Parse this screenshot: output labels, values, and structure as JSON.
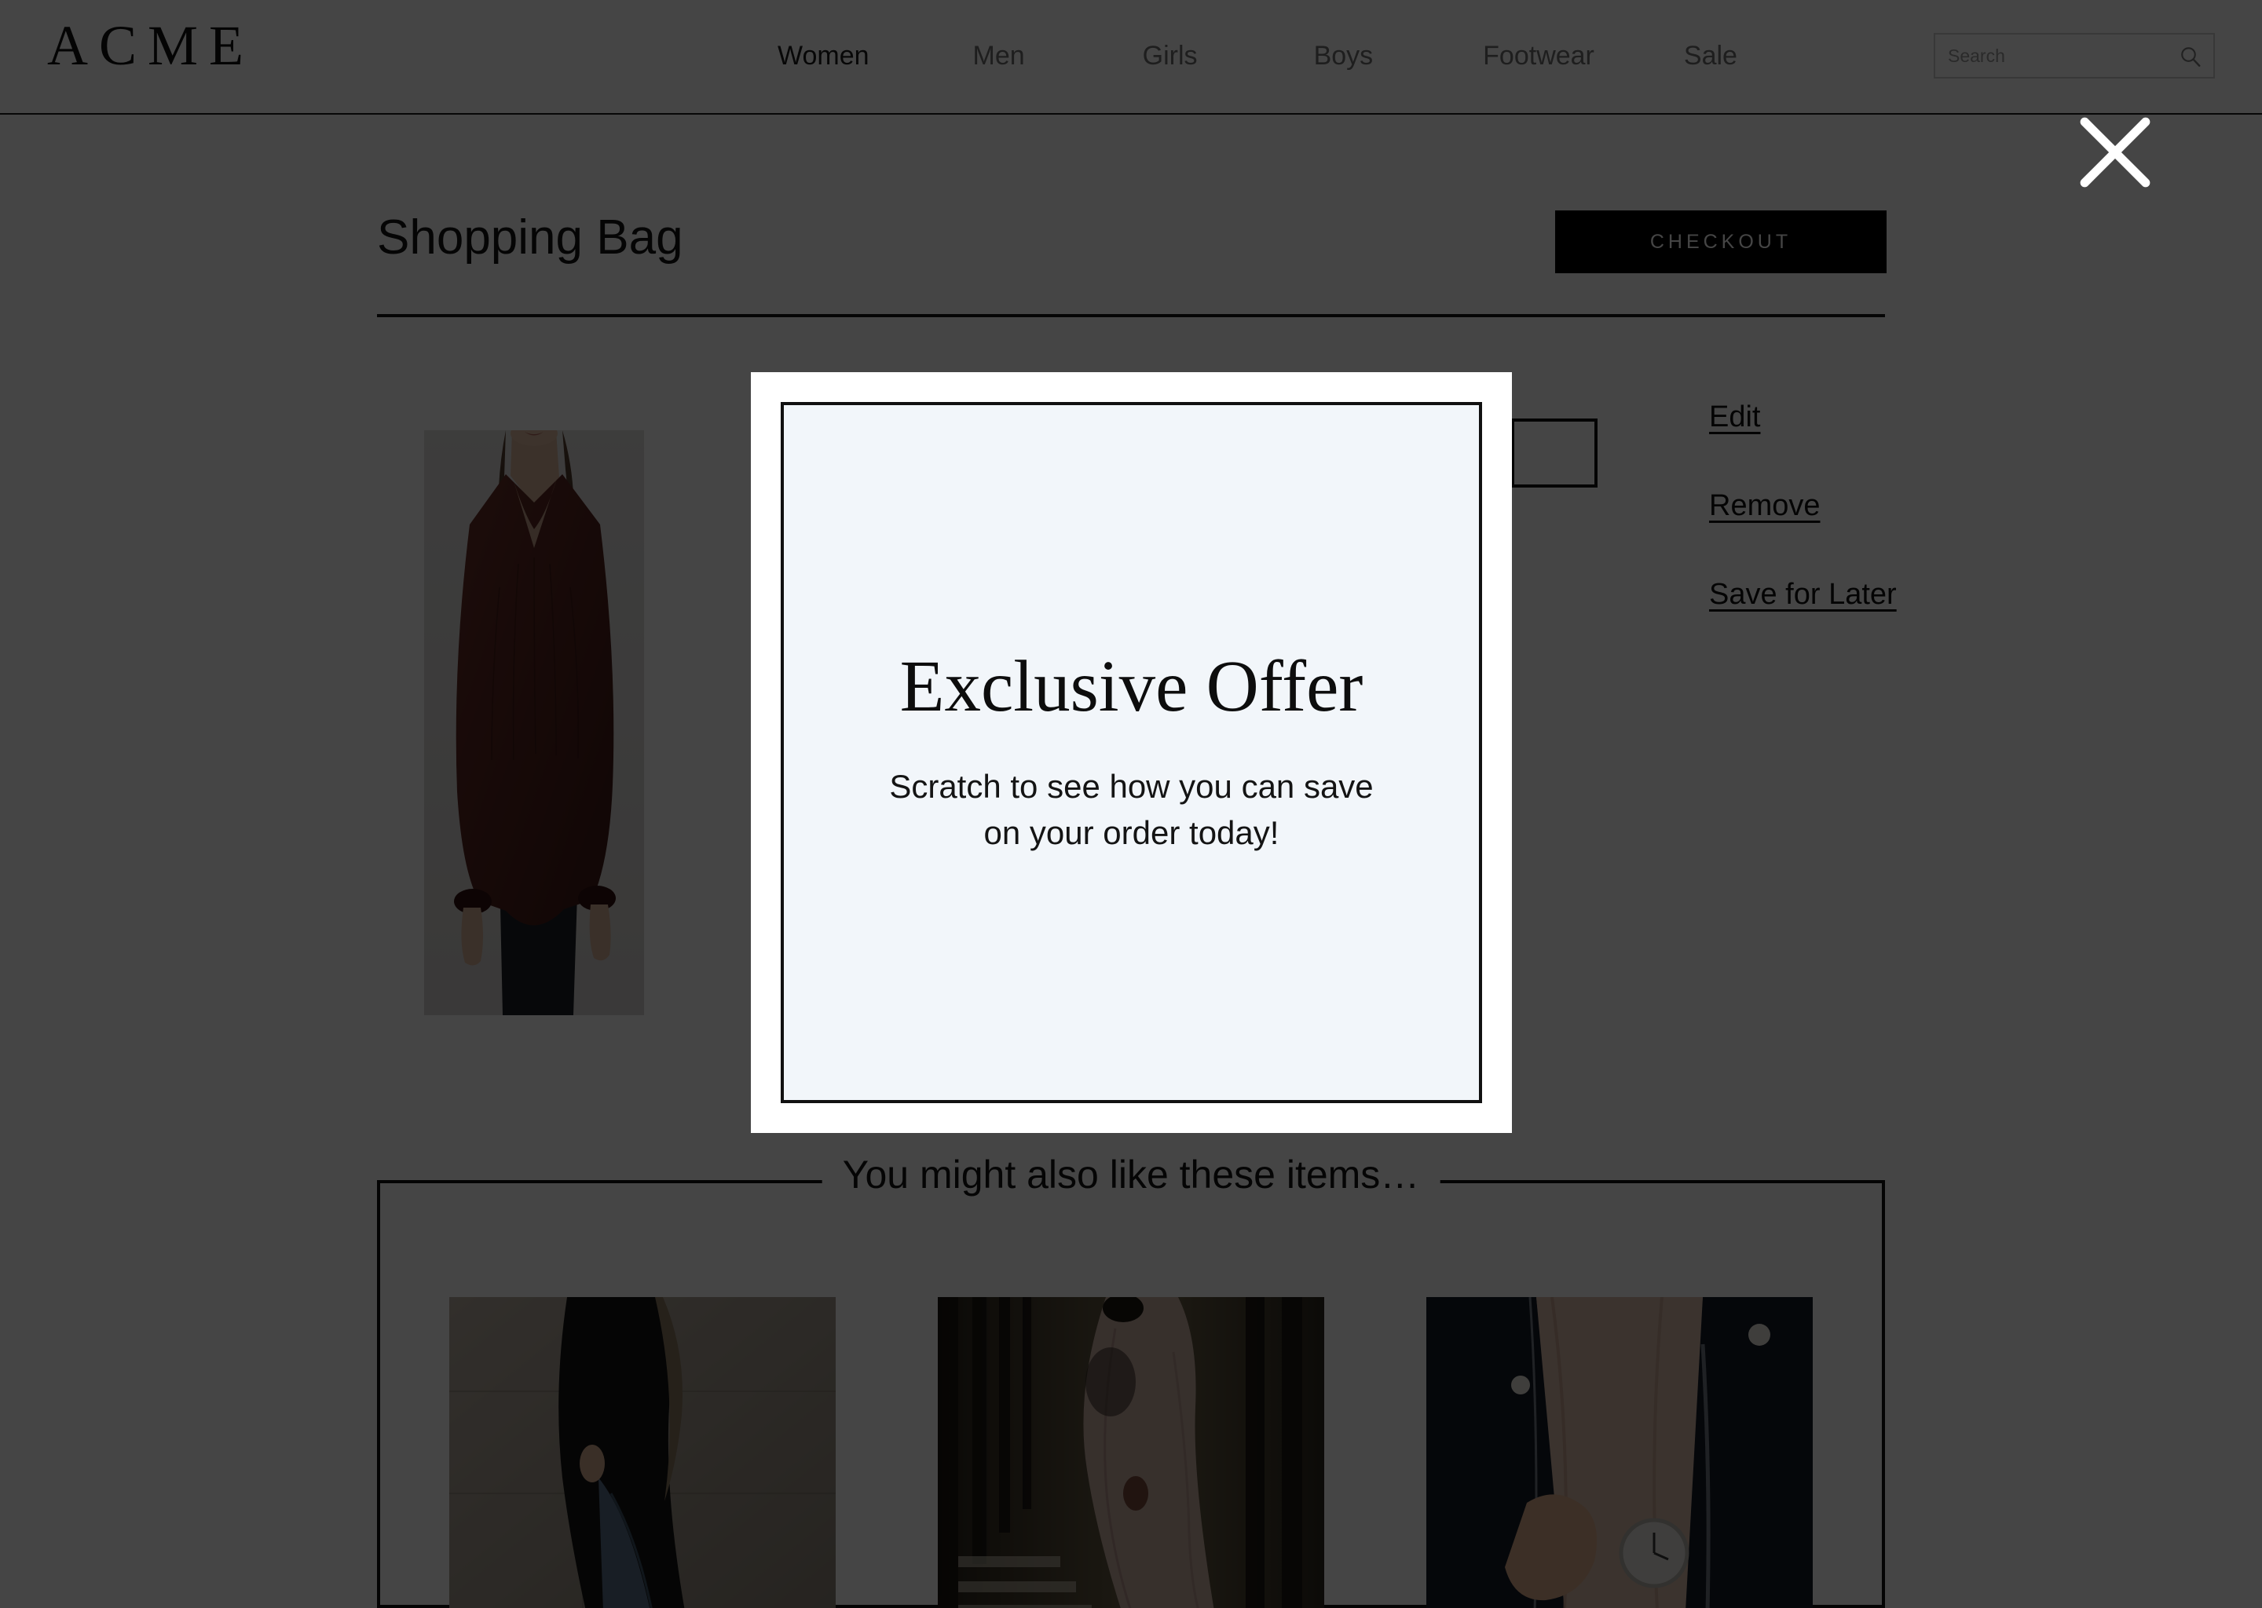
{
  "header": {
    "logo": "ACME",
    "nav": [
      {
        "label": "Women",
        "active": true
      },
      {
        "label": "Men",
        "active": false
      },
      {
        "label": "Girls",
        "active": false
      },
      {
        "label": "Boys",
        "active": false
      },
      {
        "label": "Footwear",
        "active": false
      },
      {
        "label": "Sale",
        "active": false
      }
    ],
    "search": {
      "placeholder": "Search",
      "value": "",
      "icon": "search-icon"
    }
  },
  "bag": {
    "title": "Shopping Bag",
    "checkout_label": "CHECKOUT",
    "item": {
      "image_alt": "woman wearing burgundy v-neck blouse",
      "quantity": ""
    },
    "actions": [
      {
        "label": "Edit"
      },
      {
        "label": "Remove"
      },
      {
        "label": "Save for Later"
      }
    ]
  },
  "recommendations": {
    "heading": "You might also like these items…",
    "items": [
      {
        "alt": "woman in black top and jeans against stone wall"
      },
      {
        "alt": "woman in blush maxi dress in colonnade"
      },
      {
        "alt": "wrist with watch under navy jacket and blush blouse"
      }
    ]
  },
  "modal": {
    "title": "Exclusive Offer",
    "subtitle": "Scratch to see how you can save\non your order today!",
    "close_icon": "close-icon"
  },
  "colors": {
    "overlay": "#434343",
    "modal_inner_bg": "#f2f6fa",
    "accent_black": "#000000",
    "close_icon": "#ffffff"
  }
}
